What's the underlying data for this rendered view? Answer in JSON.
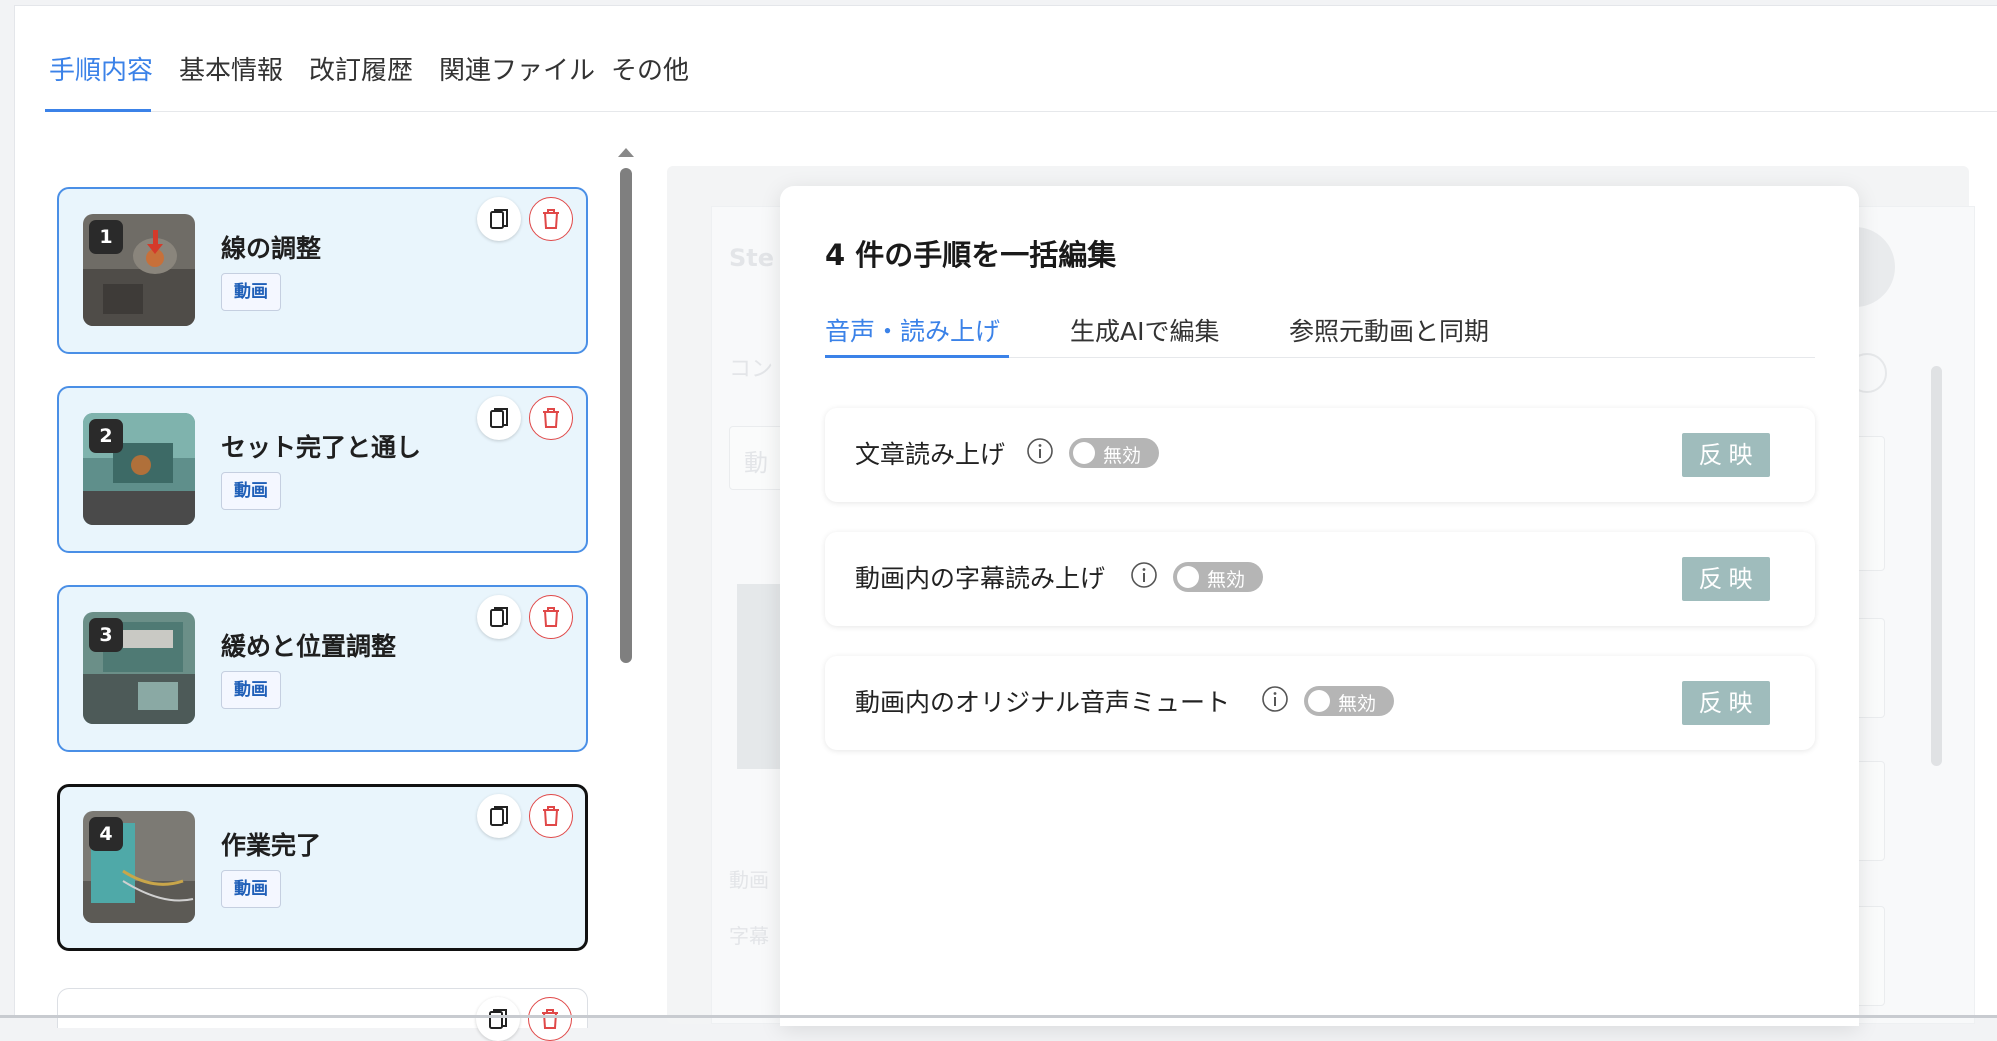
{
  "top_tabs": [
    {
      "label": "手順内容",
      "active": true
    },
    {
      "label": "基本情報"
    },
    {
      "label": "改訂履歴"
    },
    {
      "label": "関連ファイル"
    },
    {
      "label": "その他"
    }
  ],
  "steps": [
    {
      "number": "1",
      "title": "線の調整",
      "tag": "動画"
    },
    {
      "number": "2",
      "title": "セット完了と通し",
      "tag": "動画"
    },
    {
      "number": "3",
      "title": "緩めと位置調整",
      "tag": "動画"
    },
    {
      "number": "4",
      "title": "作業完了",
      "tag": "動画"
    }
  ],
  "editor_bg": {
    "step_label": "Ste",
    "content_label": "コン",
    "input_prefix": "動",
    "video_label": "動画",
    "subtitle_label": "字幕"
  },
  "modal": {
    "title": "4 件の手順を一括編集",
    "tabs": [
      {
        "label": "音声・読み上げ",
        "active": true
      },
      {
        "label": "生成AIで編集"
      },
      {
        "label": "参照元動画と同期"
      }
    ],
    "settings": [
      {
        "label": "文章読み上げ",
        "toggle": "無効",
        "button": "反映"
      },
      {
        "label": "動画内の字幕読み上げ",
        "toggle": "無効",
        "button": "反映"
      },
      {
        "label": "動画内のオリジナル音声ミュート",
        "toggle": "無効",
        "button": "反映"
      }
    ]
  },
  "colors": {
    "accent": "#3b82e8",
    "card_bg": "#e9f5fc",
    "apply_button": "#9fbcbc",
    "delete": "#e04848"
  },
  "icons": [
    "copy-icon",
    "trash-icon",
    "info-icon",
    "scroll-up-icon"
  ]
}
